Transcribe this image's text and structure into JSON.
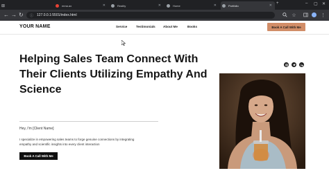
{
  "browser": {
    "tabs": [
      {
        "label": "mma.ax",
        "active": false,
        "favicon_color": "#e94235"
      },
      {
        "label": "Reality",
        "active": false,
        "favicon_color": "#9aa0a6"
      },
      {
        "label": "Home",
        "active": false,
        "favicon_color": "#9aa0a6"
      },
      {
        "label": "Portfolio",
        "active": true,
        "favicon_color": "#9aa0a6"
      }
    ],
    "url": "127.0.0.1:5501/index.html"
  },
  "site": {
    "brand": "YOUR NAME",
    "nav": [
      "Service",
      "Testimonials",
      "About Me",
      "Books"
    ],
    "cta_top": "Book A Call With Me",
    "headline": "Helping Sales Team Connect With Their Clients Utilizing Empathy And Science",
    "greeting": "Hey, I'm [Client Name]",
    "description": "I specialize in empowering sales teams to forge genuine connections by integrating empathy and scientific insights into every client interaction",
    "cta_main": "Book A Call With Me",
    "social_icons": [
      "instagram-icon",
      "twitter-icon",
      "linkedin-icon"
    ]
  },
  "colors": {
    "accent": "#d18d68",
    "dark": "#0f0f0f",
    "chrome": "#202124"
  }
}
